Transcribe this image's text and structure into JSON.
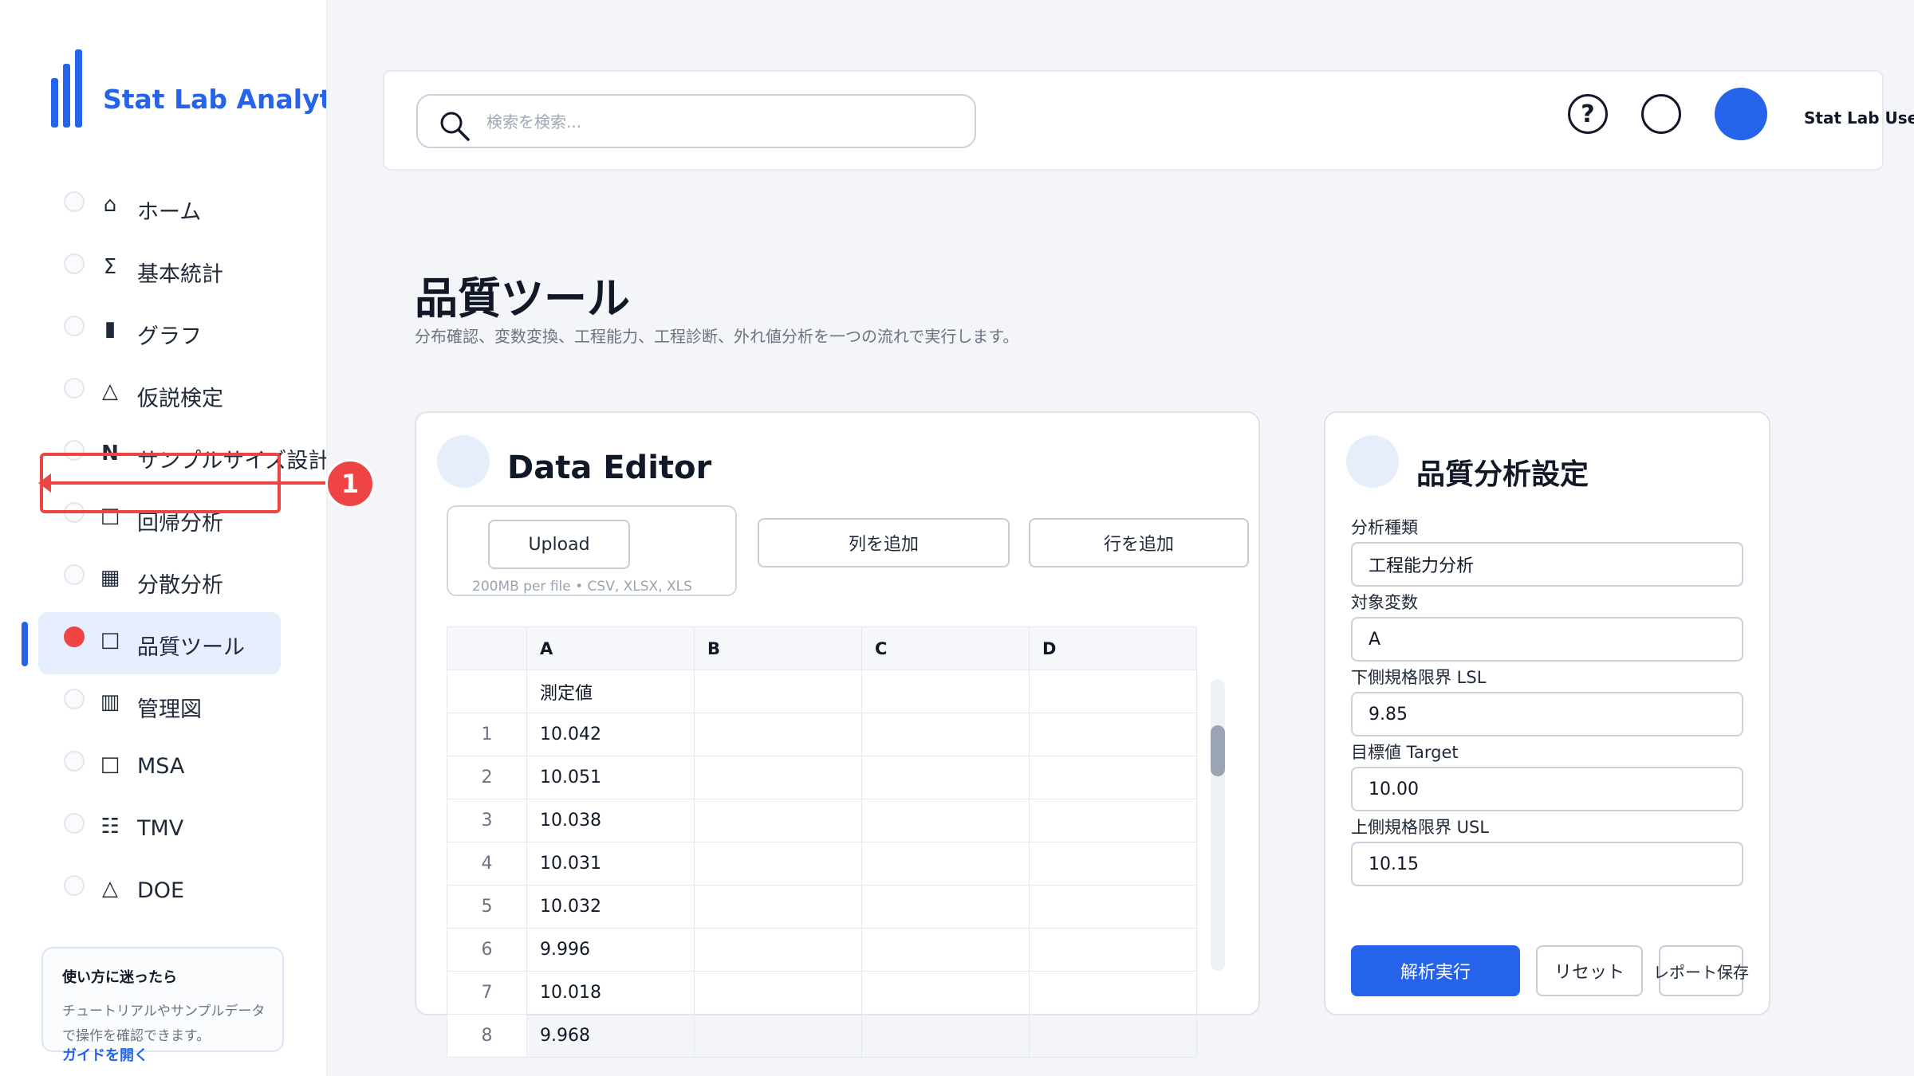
{
  "brand": {
    "title": "Stat Lab Analytics"
  },
  "sidebar": {
    "items": [
      {
        "icon": "⌂",
        "label": "ホーム",
        "active": false
      },
      {
        "icon": "Σ",
        "label": "基本統計",
        "active": false
      },
      {
        "icon": "▮",
        "label": "グラフ",
        "active": false
      },
      {
        "icon": "△",
        "label": "仮説検定",
        "active": false
      },
      {
        "icon": "N",
        "label": "サンプルサイズ設計",
        "active": false
      },
      {
        "icon": "□",
        "label": "回帰分析",
        "active": false
      },
      {
        "icon": "▦",
        "label": "分散分析",
        "active": false
      },
      {
        "icon": "□",
        "label": "品質ツール",
        "active": true
      },
      {
        "icon": "▥",
        "label": "管理図",
        "active": false
      },
      {
        "icon": "□",
        "label": "MSA",
        "active": false
      },
      {
        "icon": "☷",
        "label": "TMV",
        "active": false
      },
      {
        "icon": "△",
        "label": "DOE",
        "active": false
      }
    ],
    "help": {
      "title": "使い方に迷ったら",
      "text": "チュートリアルやサンプルデータで操作を確認できます。",
      "link": "ガイドを開く"
    }
  },
  "annotation": {
    "badge": "1"
  },
  "header": {
    "search_placeholder": "検索を検索...",
    "help_glyph": "?",
    "user_name": "Stat Lab User"
  },
  "page": {
    "title": "品質ツール",
    "subtitle": "分布確認、変数変換、工程能力、工程診断、外れ値分析を一つの流れで実行します。"
  },
  "editor": {
    "title": "Data Editor",
    "upload_label": "Upload",
    "upload_hint": "200MB per file • CSV, XLSX, XLS",
    "add_column": "列を追加",
    "add_row": "行を追加",
    "columns": [
      "A",
      "B",
      "C",
      "D"
    ],
    "header_row": [
      "測定値",
      "",
      "",
      ""
    ],
    "rows": [
      {
        "idx": "1",
        "A": "10.042"
      },
      {
        "idx": "2",
        "A": "10.051"
      },
      {
        "idx": "3",
        "A": "10.038"
      },
      {
        "idx": "4",
        "A": "10.031"
      },
      {
        "idx": "5",
        "A": "10.032"
      },
      {
        "idx": "6",
        "A": "9.996"
      },
      {
        "idx": "7",
        "A": "10.018"
      },
      {
        "idx": "8",
        "A": "9.968"
      }
    ]
  },
  "settings": {
    "title": "品質分析設定",
    "analysis_type_label": "分析種類",
    "analysis_type": "工程能力分析",
    "target_var_label": "対象変数",
    "target_var": "A",
    "lsl_label": "下側規格限界 LSL",
    "lsl": "9.85",
    "target_label": "目標値 Target",
    "target": "10.00",
    "usl_label": "上側規格限界 USL",
    "usl": "10.15",
    "run_button": "解析実行",
    "reset_button": "リセット",
    "save_button": "レポート保存"
  },
  "colors": {
    "accent": "#2563eb",
    "active_dot": "#ef4444",
    "annotation": "#ef4444"
  }
}
